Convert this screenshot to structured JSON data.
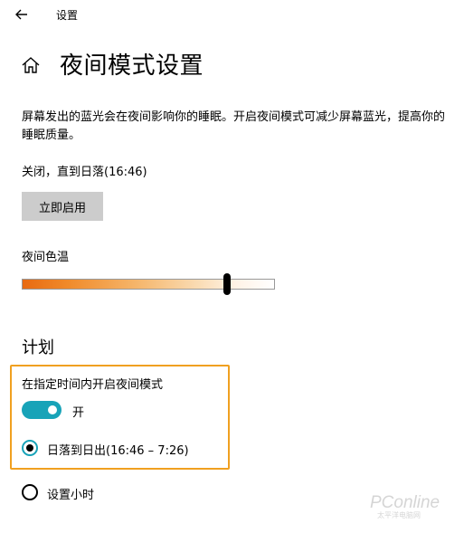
{
  "titlebar": {
    "back_icon": "arrow-left-icon",
    "app_title": "设置"
  },
  "header": {
    "home_icon": "home-icon",
    "title": "夜间模式设置"
  },
  "description": "屏幕发出的蓝光会在夜间影响你的睡眠。开启夜间模式可减少屏幕蓝光，提高你的睡眠质量。",
  "status_text": "关闭，直到日落(16:46)",
  "enable_now_button": "立即启用",
  "color_temperature": {
    "label": "夜间色温",
    "level": 0.81
  },
  "schedule": {
    "heading": "计划",
    "toggle_label": "在指定时间内开启夜间模式",
    "toggle_on": true,
    "toggle_state_text": "开",
    "options": [
      {
        "label": "日落到日出(16:46 – 7:26)",
        "selected": true
      },
      {
        "label": "设置小时",
        "selected": false
      }
    ]
  },
  "colors": {
    "accent": "#18a3b8",
    "highlight": "#f0a020",
    "button_bg": "#cccccc"
  }
}
